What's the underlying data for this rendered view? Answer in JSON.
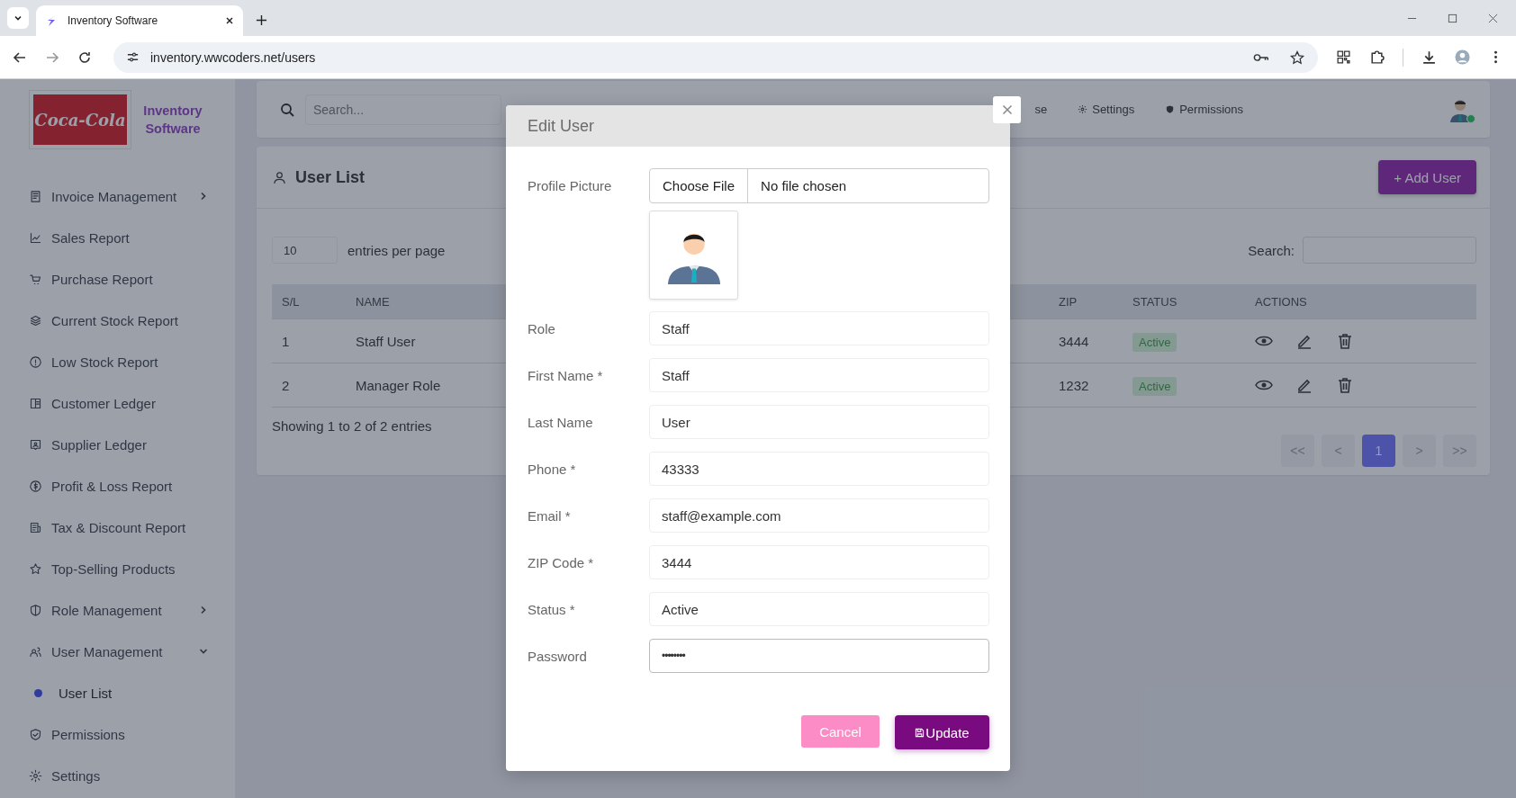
{
  "browser": {
    "tab_title": "Inventory Software",
    "url": "inventory.wwcoders.net/users"
  },
  "sidebar": {
    "logo_text": "Coca-Cola",
    "brand": "Inventory Software",
    "items": [
      {
        "label": "Invoice Management",
        "expanded": false
      },
      {
        "label": "Sales Report"
      },
      {
        "label": "Purchase Report"
      },
      {
        "label": "Current Stock Report"
      },
      {
        "label": "Low Stock Report"
      },
      {
        "label": "Customer Ledger"
      },
      {
        "label": "Supplier Ledger"
      },
      {
        "label": "Profit & Loss Report"
      },
      {
        "label": "Tax & Discount Report"
      },
      {
        "label": "Top-Selling Products"
      },
      {
        "label": "Role Management",
        "expanded": false
      },
      {
        "label": "User Management",
        "expanded": true,
        "children": [
          {
            "label": "User List",
            "selected": true
          }
        ]
      },
      {
        "label": "Permissions"
      },
      {
        "label": "Settings"
      }
    ]
  },
  "topbar": {
    "search": {
      "placeholder": "Search..."
    },
    "nav": [
      "se",
      "Settings",
      "Permissions"
    ],
    "online": true
  },
  "user_list": {
    "title": "User List",
    "add_button": "+ Add User",
    "entries_value": "10",
    "entries_label": "entries per page",
    "search_label": "Search:",
    "columns": [
      "S/L",
      "NAME",
      "ZIP",
      "STATUS",
      "ACTIONS"
    ],
    "rows": [
      {
        "sl": "1",
        "name": "Staff User",
        "zip": "3444",
        "status": "Active"
      },
      {
        "sl": "2",
        "name": "Manager Role",
        "zip": "1232",
        "status": "Active"
      }
    ],
    "footer": "Showing 1 to 2 of 2 entries",
    "pagination": [
      {
        "label": "<<",
        "selected": false
      },
      {
        "label": "<",
        "selected": false
      },
      {
        "label": "1",
        "selected": true
      },
      {
        "label": ">",
        "selected": false
      },
      {
        "label": ">>",
        "selected": false
      }
    ]
  },
  "modal": {
    "title": "Edit User",
    "fields": [
      {
        "kind": "file",
        "label": "Profile Picture",
        "button": "Choose File",
        "value": "No file chosen"
      },
      {
        "kind": "image"
      },
      {
        "kind": "text",
        "label": "Role",
        "value": "Staff"
      },
      {
        "kind": "text",
        "label": "First Name *",
        "value": "Staff"
      },
      {
        "kind": "text",
        "label": "Last Name",
        "value": "User"
      },
      {
        "kind": "text",
        "label": "Phone *",
        "value": "43333"
      },
      {
        "kind": "text",
        "label": "Email *",
        "value": "staff@example.com"
      },
      {
        "kind": "text",
        "label": "ZIP Code *",
        "value": "3444"
      },
      {
        "kind": "text",
        "label": "Status *",
        "value": "Active"
      },
      {
        "kind": "password",
        "label": "Password",
        "value": "••••••••"
      }
    ],
    "cancel": "Cancel",
    "submit": "Update"
  }
}
